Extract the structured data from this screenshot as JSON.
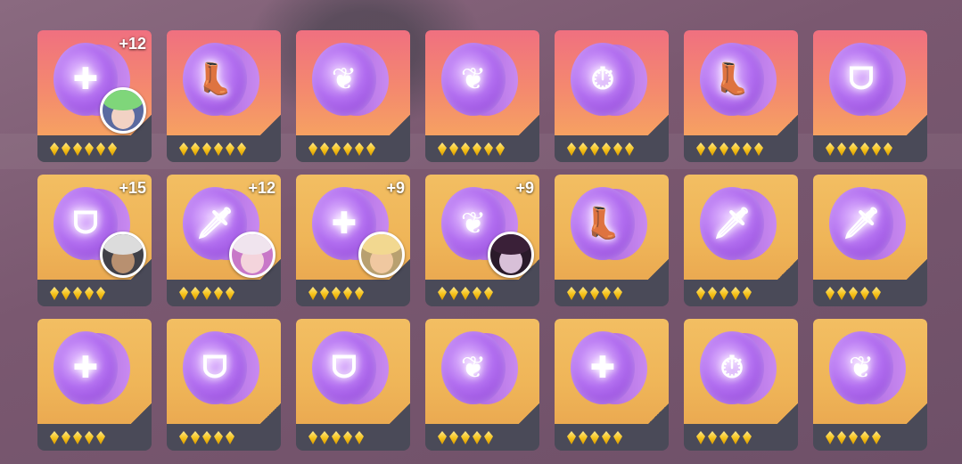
{
  "colors": {
    "red_card": "#f07080",
    "gold_card": "#f2be62",
    "disc": "#b26ef0",
    "star": "#f5c21a"
  },
  "rows": [
    [
      {
        "tier": "red",
        "icon": "plus-icon",
        "glyph": "✚",
        "level": "+12",
        "stars": 6,
        "avatar": {
          "hair": "#7fd67a",
          "skin": "#f2d2c4",
          "bg": "#5a6aa0"
        }
      },
      {
        "tier": "red",
        "icon": "boot-icon",
        "glyph": "👢",
        "level": "",
        "stars": 6,
        "avatar": null
      },
      {
        "tier": "red",
        "icon": "feather-icon",
        "glyph": "❦",
        "level": "",
        "stars": 6,
        "avatar": null
      },
      {
        "tier": "red",
        "icon": "feather-icon",
        "glyph": "❦",
        "level": "",
        "stars": 6,
        "avatar": null
      },
      {
        "tier": "red",
        "icon": "stopwatch-icon",
        "glyph": "⏱",
        "level": "",
        "stars": 6,
        "avatar": null
      },
      {
        "tier": "red",
        "icon": "boot-icon",
        "glyph": "👢",
        "level": "",
        "stars": 6,
        "avatar": null
      },
      {
        "tier": "red",
        "icon": "fang-icon",
        "glyph": "ᗜ",
        "level": "",
        "stars": 6,
        "avatar": null
      }
    ],
    [
      {
        "tier": "gold",
        "icon": "fang-icon",
        "glyph": "ᗜ",
        "level": "+15",
        "stars": 5,
        "avatar": {
          "hair": "#dcdcdc",
          "skin": "#b89070",
          "bg": "#404048"
        }
      },
      {
        "tier": "gold",
        "icon": "sword-icon",
        "glyph": "🗡",
        "level": "+12",
        "stars": 5,
        "avatar": {
          "hair": "#f0e4ee",
          "skin": "#f4d4dc",
          "bg": "#c878c8"
        }
      },
      {
        "tier": "gold",
        "icon": "plus-icon",
        "glyph": "✚",
        "level": "+9",
        "stars": 5,
        "avatar": {
          "hair": "#f2d890",
          "skin": "#f0c8a0",
          "bg": "#b8a070"
        }
      },
      {
        "tier": "gold",
        "icon": "feather-icon",
        "glyph": "❦",
        "level": "+9",
        "stars": 5,
        "avatar": {
          "hair": "#3a2038",
          "skin": "#d8c0d8",
          "bg": "#2a1a2a"
        }
      },
      {
        "tier": "gold",
        "icon": "boot-icon",
        "glyph": "👢",
        "level": "",
        "stars": 5,
        "avatar": null
      },
      {
        "tier": "gold",
        "icon": "sword-icon",
        "glyph": "🗡",
        "level": "",
        "stars": 5,
        "avatar": null
      },
      {
        "tier": "gold",
        "icon": "sword-icon",
        "glyph": "🗡",
        "level": "",
        "stars": 5,
        "avatar": null
      }
    ],
    [
      {
        "tier": "gold",
        "icon": "plus-icon",
        "glyph": "✚",
        "level": "",
        "stars": 5,
        "avatar": null
      },
      {
        "tier": "gold",
        "icon": "fang-icon",
        "glyph": "ᗜ",
        "level": "",
        "stars": 5,
        "avatar": null
      },
      {
        "tier": "gold",
        "icon": "fang-icon",
        "glyph": "ᗜ",
        "level": "",
        "stars": 5,
        "avatar": null
      },
      {
        "tier": "gold",
        "icon": "feather-icon",
        "glyph": "❦",
        "level": "",
        "stars": 5,
        "avatar": null
      },
      {
        "tier": "gold",
        "icon": "plus-icon",
        "glyph": "✚",
        "level": "",
        "stars": 5,
        "avatar": null
      },
      {
        "tier": "gold",
        "icon": "stopwatch-icon",
        "glyph": "⏱",
        "level": "",
        "stars": 5,
        "avatar": null
      },
      {
        "tier": "gold",
        "icon": "feather-icon",
        "glyph": "❦",
        "level": "",
        "stars": 5,
        "avatar": null
      }
    ]
  ]
}
